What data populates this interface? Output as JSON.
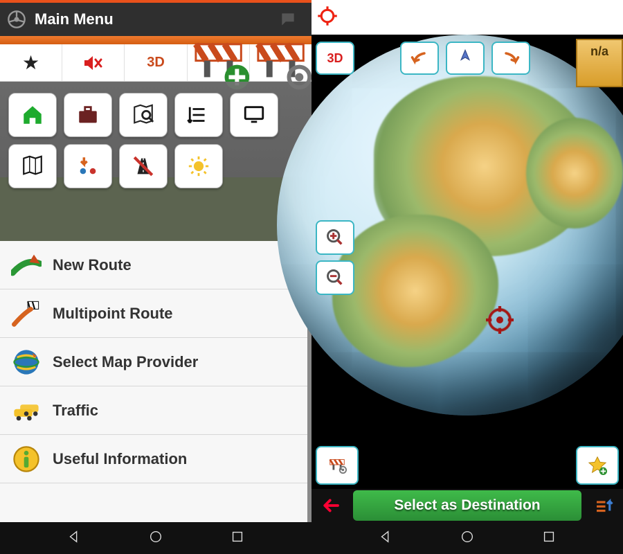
{
  "left": {
    "header": {
      "title": "Main Menu"
    },
    "toolbar": {
      "view_mode": "3D"
    },
    "menu": [
      {
        "label": "New Route"
      },
      {
        "label": "Multipoint Route"
      },
      {
        "label": "Select Map Provider"
      },
      {
        "label": "Traffic"
      },
      {
        "label": "Useful Information"
      }
    ]
  },
  "right": {
    "view_mode": "3D",
    "status_box": "n/a",
    "destination_button": "Select as Destination"
  }
}
